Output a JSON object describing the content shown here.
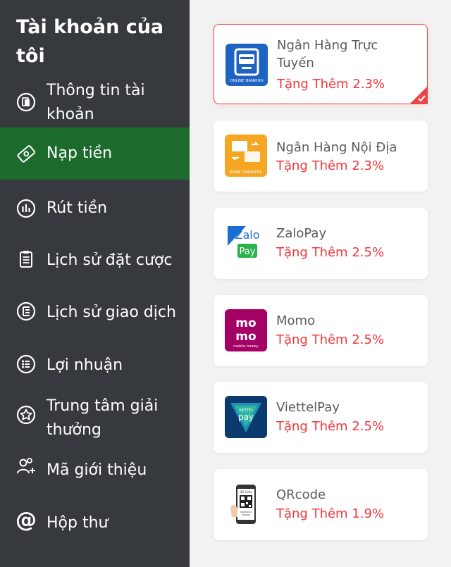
{
  "sidebar": {
    "title": "Tài khoản của tôi",
    "items": [
      {
        "label": "Thông tin tài khoản",
        "icon": "account-info-icon"
      },
      {
        "label": "Nạp tiền",
        "icon": "deposit-icon",
        "active": true
      },
      {
        "label": "Rút tiền",
        "icon": "withdraw-icon"
      },
      {
        "label": "Lịch sử đặt cược",
        "icon": "bet-history-icon"
      },
      {
        "label": "Lịch sử giao dịch",
        "icon": "transaction-history-icon"
      },
      {
        "label": "Lợi nhuận",
        "icon": "profit-icon"
      },
      {
        "label": "Trung tâm giải thưởng",
        "icon": "reward-center-icon"
      },
      {
        "label": "Mã giới thiệu",
        "icon": "referral-icon"
      },
      {
        "label": "Hộp thư",
        "icon": "mailbox-icon"
      }
    ]
  },
  "methods": [
    {
      "name": "Ngân Hàng Trực Tuyến",
      "bonus": "Tặng Thêm 2.3%",
      "selected": true,
      "logo_text": "ONLINE BANKING"
    },
    {
      "name": "Ngân Hàng Nội Địa",
      "bonus": "Tặng Thêm 2.3%",
      "logo_text": "BANK TRANSFER"
    },
    {
      "name": "ZaloPay",
      "bonus": "Tặng Thêm 2.5%",
      "logo_text": "Zalo Pay"
    },
    {
      "name": "Momo",
      "bonus": "Tặng Thêm 2.5%",
      "logo_text": "mo mo mobile money"
    },
    {
      "name": "ViettelPay",
      "bonus": "Tặng Thêm 2.5%",
      "logo_text": "VIETTEL pay"
    },
    {
      "name": "QRcode",
      "bonus": "Tặng Thêm 1.9%",
      "logo_text": "QR Code"
    }
  ],
  "colors": {
    "sidebar_bg": "#36393d",
    "active_bg": "#1c6b2c",
    "bonus_red": "#f0383c",
    "page_bg": "#f2f2f2"
  }
}
